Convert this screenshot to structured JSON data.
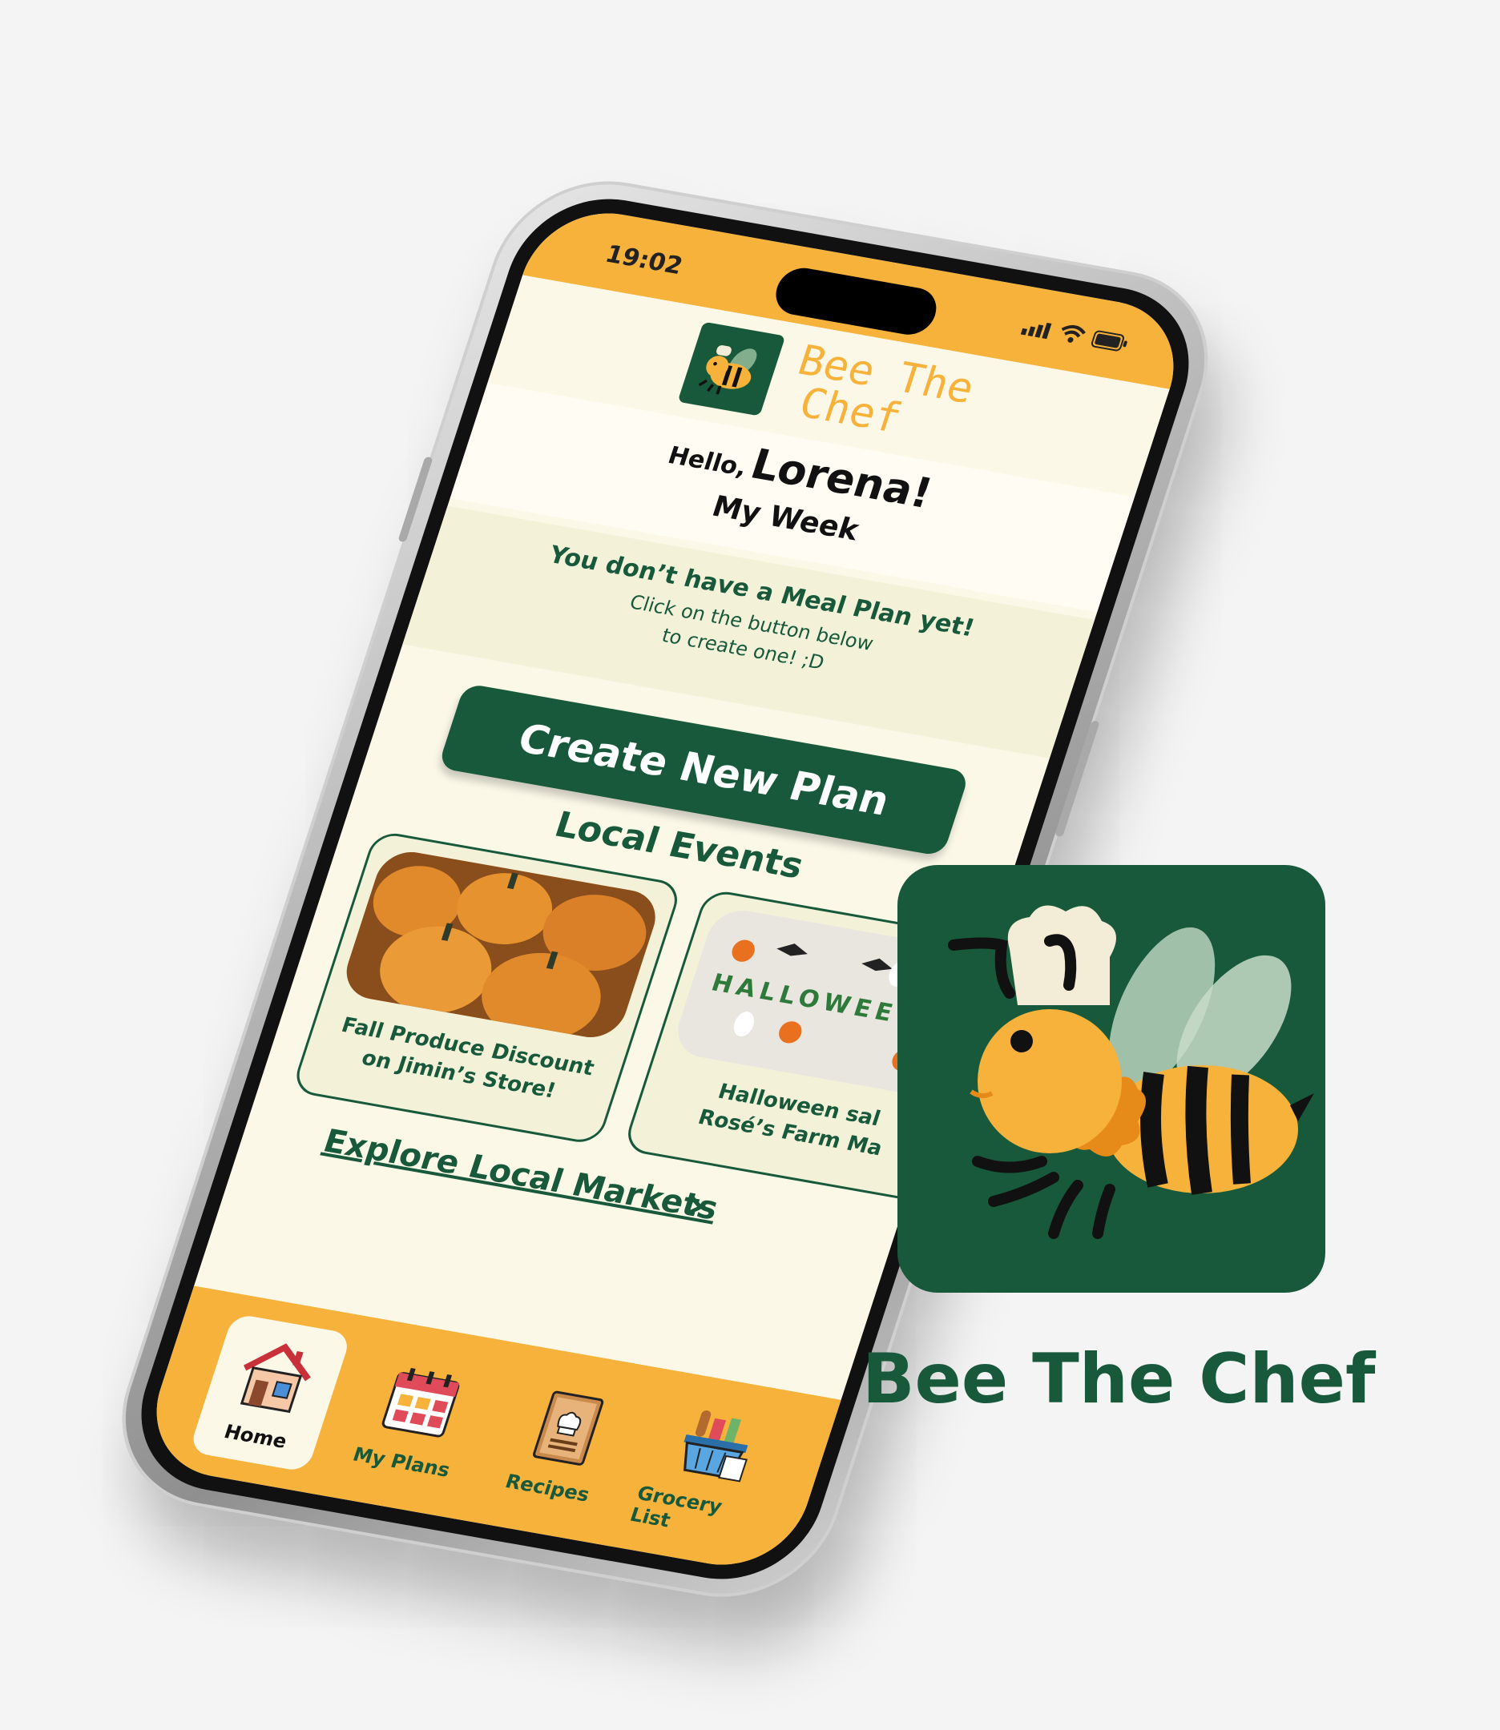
{
  "status_bar": {
    "time": "19:02"
  },
  "header": {
    "title_line1": "Bee The",
    "title_line2": "Chef"
  },
  "greeting": {
    "hello": "Hello,",
    "name": "Lorena!"
  },
  "my_week": "My Week",
  "meal_plan": {
    "title": "You don’t have a Meal Plan yet!",
    "line1": "Click on the button below",
    "line2": "to create one! ;D"
  },
  "create_button": "Create New Plan",
  "local_events": {
    "title": "Local Events",
    "cards": [
      {
        "line1": "Fall Produce Discount",
        "line2": "on Jimin’s Store!"
      },
      {
        "line1": "Halloween sal",
        "line2": "Rosé’s Farm Ma"
      }
    ],
    "halloween_text": "HALLOWEE"
  },
  "explore": {
    "label": "Explore Local Markets",
    "chevron": "›"
  },
  "tabs": [
    {
      "label": "Home",
      "icon": "house-icon"
    },
    {
      "label": "My Plans",
      "icon": "calendar-icon"
    },
    {
      "label": "Recipes",
      "icon": "recipe-book-icon"
    },
    {
      "label": "Grocery List",
      "icon": "grocery-basket-icon"
    }
  ],
  "brand": {
    "name": "Bee The Chef"
  },
  "colors": {
    "primary_green": "#17593a",
    "accent_yellow": "#f7b23b",
    "cream": "#fbf8e8"
  }
}
